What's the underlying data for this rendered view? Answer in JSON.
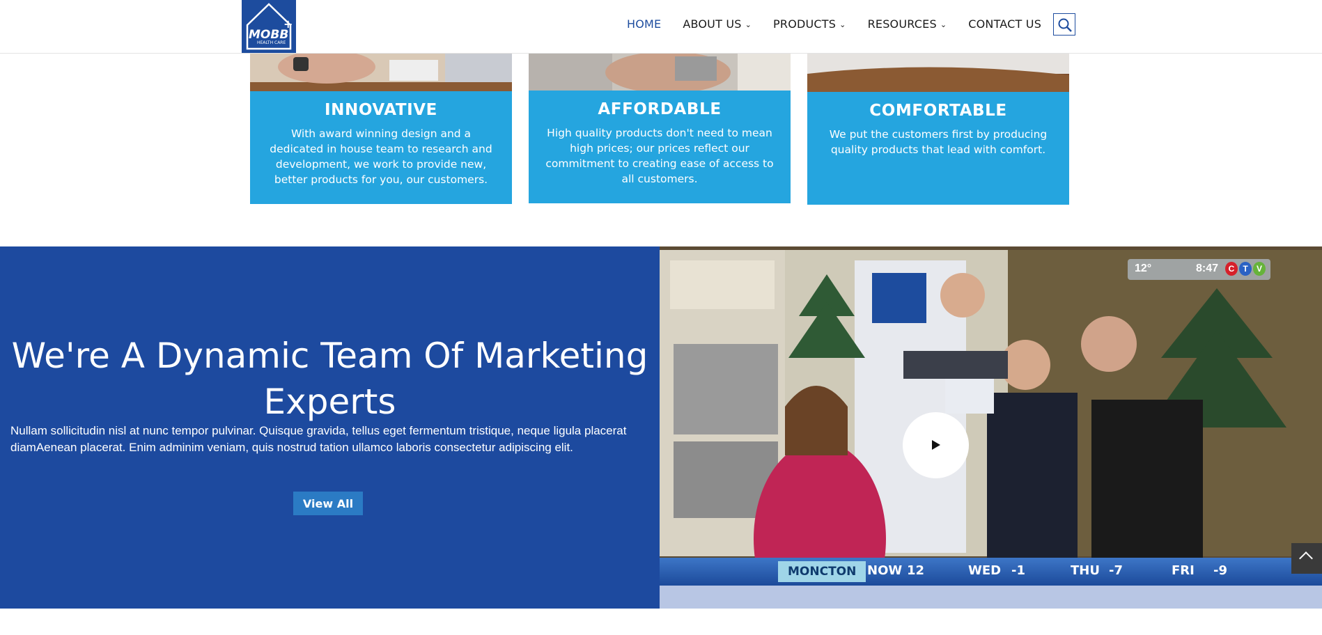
{
  "header": {
    "logo_text": "MOBB",
    "logo_subtext": "HEALTH CARE",
    "nav": [
      {
        "label": "HOME",
        "active": true,
        "dropdown": false
      },
      {
        "label": "ABOUT US",
        "active": false,
        "dropdown": true
      },
      {
        "label": "PRODUCTS",
        "active": false,
        "dropdown": true
      },
      {
        "label": "RESOURCES",
        "active": false,
        "dropdown": true
      },
      {
        "label": "CONTACT US",
        "active": false,
        "dropdown": false
      }
    ],
    "search_icon": "search-icon"
  },
  "features": [
    {
      "title": "INNOVATIVE",
      "text": "With award winning design and a dedicated in house team to research and development, we work to provide new, better products for you, our customers."
    },
    {
      "title": "AFFORDABLE",
      "text": "High quality products don't need to mean high prices; our prices reflect our commitment to creating ease of access to all customers."
    },
    {
      "title": "COMFORTABLE",
      "text": "We put the customers first by producing quality products that lead with comfort."
    }
  ],
  "team": {
    "heading": "We're A Dynamic Team Of Marketing Experts",
    "body": "Nullam sollicitudin nisl at nunc tempor pulvinar. Quisque gravida, tellus eget fermentum tristique, neque ligula placerat diamAenean placerat. Enim adminim veniam, quis nostrud tation ullamco laboris consectetur adipiscing elit.",
    "button": "View All"
  },
  "video": {
    "play_icon": "play-icon",
    "bug_temp": "12°",
    "bug_time": "8:47",
    "bug_network": [
      "C",
      "T",
      "V"
    ],
    "ticker_city": "MONCTON",
    "ticker": [
      {
        "day": "NOW",
        "temp": "12"
      },
      {
        "day": "WED",
        "temp": "-1"
      },
      {
        "day": "THU",
        "temp": "-7"
      },
      {
        "day": "FRI",
        "temp": "-9"
      }
    ]
  },
  "colors": {
    "brand_blue": "#1d4a9f",
    "card_blue": "#25a5df",
    "button_blue": "#2b7bc4",
    "nav_active": "#1d4c9e"
  }
}
